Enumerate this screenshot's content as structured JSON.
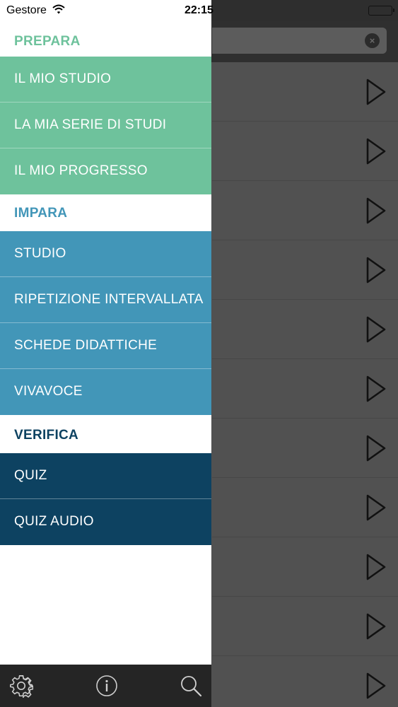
{
  "status_bar": {
    "carrier": "Gestore",
    "time": "22:15",
    "icons": [
      "wifi-icon",
      "battery-icon"
    ]
  },
  "background_screen": {
    "search_clear_icon": "clear-icon",
    "row_icon": "play-icon",
    "row_count": 11
  },
  "menu": {
    "sections": [
      {
        "title": "PREPARA",
        "color": "#6ec29c",
        "items": [
          "IL MIO STUDIO",
          "LA MIA SERIE DI STUDI",
          "IL MIO PROGRESSO"
        ]
      },
      {
        "title": "IMPARA",
        "color": "#4296b8",
        "items": [
          "STUDIO",
          "RIPETIZIONE INTERVALLATA",
          "SCHEDE DIDATTICHE",
          "VIVAVOCE"
        ]
      },
      {
        "title": "VERIFICA",
        "color": "#0d4261",
        "items": [
          "QUIZ",
          "QUIZ AUDIO"
        ]
      }
    ]
  },
  "tab_bar": {
    "icons": [
      "gear-icon",
      "info-icon",
      "search-icon"
    ]
  }
}
